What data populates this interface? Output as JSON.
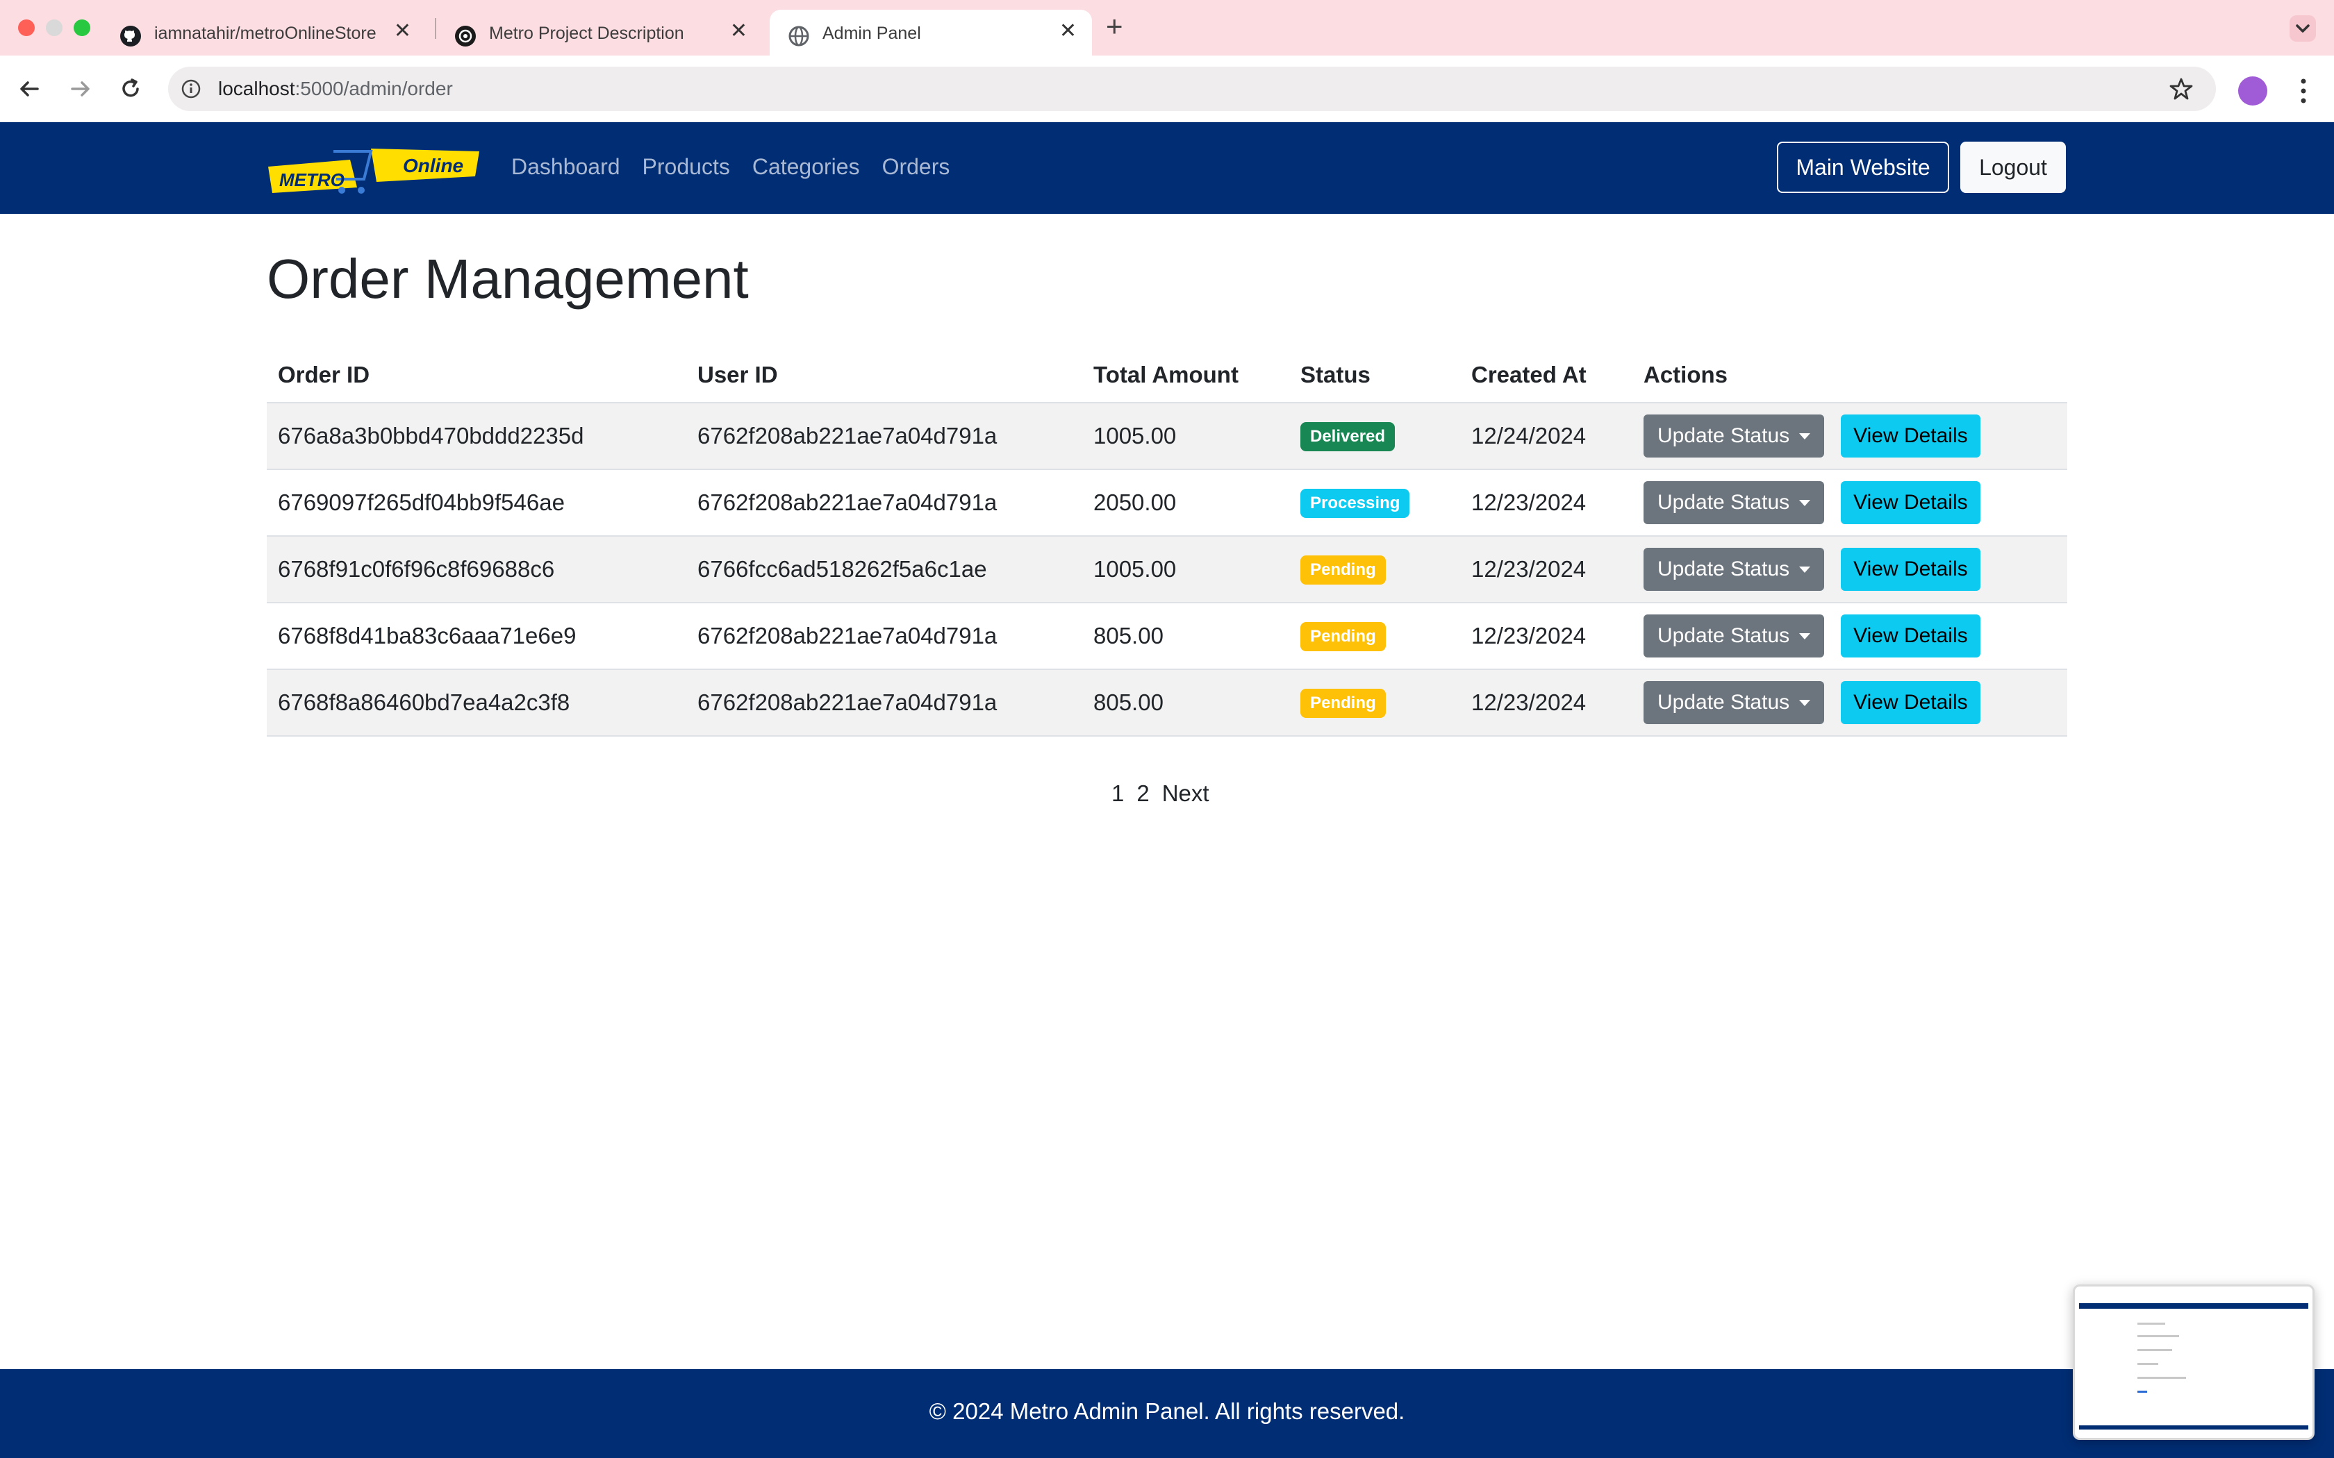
{
  "browser": {
    "tabs": [
      {
        "title": "iamnatahir/metroOnlineStore",
        "icon": "github-icon"
      },
      {
        "title": "Metro Project Description",
        "icon": "chatgpt-icon"
      },
      {
        "title": "Admin Panel",
        "icon": "globe-icon",
        "active": true
      }
    ],
    "url_host": "localhost",
    "url_path": ":5000/admin/order"
  },
  "navbar": {
    "logo_text_main": "METRO",
    "logo_text_badge": "Online",
    "links": [
      "Dashboard",
      "Products",
      "Categories",
      "Orders"
    ],
    "main_website_label": "Main Website",
    "logout_label": "Logout"
  },
  "main": {
    "title": "Order Management",
    "table": {
      "headers": [
        "Order ID",
        "User ID",
        "Total Amount",
        "Status",
        "Created At",
        "Actions"
      ],
      "rows": [
        {
          "order_id": "676a8a3b0bbd470bddd2235d",
          "user_id": "6762f208ab221ae7a04d791a",
          "total": "1005.00",
          "status": "Delivered",
          "created_at": "12/24/2024"
        },
        {
          "order_id": "6769097f265df04bb9f546ae",
          "user_id": "6762f208ab221ae7a04d791a",
          "total": "2050.00",
          "status": "Processing",
          "created_at": "12/23/2024"
        },
        {
          "order_id": "6768f91c0f6f96c8f69688c6",
          "user_id": "6766fcc6ad518262f5a6c1ae",
          "total": "1005.00",
          "status": "Pending",
          "created_at": "12/23/2024"
        },
        {
          "order_id": "6768f8d41ba83c6aaa71e6e9",
          "user_id": "6762f208ab221ae7a04d791a",
          "total": "805.00",
          "status": "Pending",
          "created_at": "12/23/2024"
        },
        {
          "order_id": "6768f8a86460bd7ea4a2c3f8",
          "user_id": "6762f208ab221ae7a04d791a",
          "total": "805.00",
          "status": "Pending",
          "created_at": "12/23/2024"
        }
      ],
      "update_status_label": "Update Status",
      "view_details_label": "View Details"
    },
    "pagination": {
      "pages": [
        "1",
        "2"
      ],
      "next_label": "Next"
    }
  },
  "footer": {
    "text": "© 2024 Metro Admin Panel. All rights reserved."
  },
  "colors": {
    "navbar": "#002d74",
    "tabbar": "#fcdde2",
    "success": "#198754",
    "info": "#0dcaf0",
    "warning": "#ffc107",
    "secondary": "#6c757d"
  }
}
